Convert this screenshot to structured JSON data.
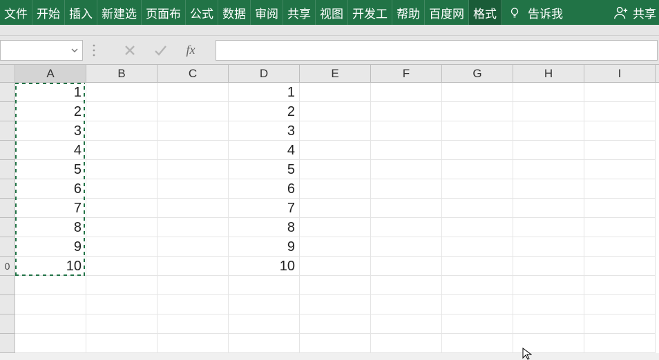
{
  "ribbon": {
    "tabs": [
      {
        "label": "文件"
      },
      {
        "label": "开始"
      },
      {
        "label": "插入"
      },
      {
        "label": "新建选"
      },
      {
        "label": "页面布"
      },
      {
        "label": "公式"
      },
      {
        "label": "数据"
      },
      {
        "label": "审阅"
      },
      {
        "label": "共享"
      },
      {
        "label": "视图"
      },
      {
        "label": "开发工"
      },
      {
        "label": "帮助"
      },
      {
        "label": "百度网"
      },
      {
        "label": "格式",
        "active": true
      }
    ],
    "tell_me": "告诉我",
    "share": "共享"
  },
  "fbar": {
    "namebox": "",
    "fx_label": "fx",
    "formula": ""
  },
  "grid": {
    "cols": [
      "A",
      "B",
      "C",
      "D",
      "E",
      "F",
      "G",
      "H",
      "I"
    ],
    "row_headers": [
      "",
      "",
      "",
      "",
      "",
      "",
      "",
      "",
      "",
      "0",
      "",
      "",
      "",
      ""
    ],
    "cells": {
      "A": [
        "1",
        "2",
        "3",
        "4",
        "5",
        "6",
        "7",
        "8",
        "9",
        "10",
        "",
        "",
        "",
        ""
      ],
      "D": [
        "1",
        "2",
        "3",
        "4",
        "5",
        "6",
        "7",
        "8",
        "9",
        "10",
        "",
        "",
        "",
        ""
      ]
    }
  },
  "chart_data": {
    "type": "table",
    "columns": [
      "A",
      "B",
      "C",
      "D",
      "E",
      "F",
      "G",
      "H",
      "I"
    ],
    "rows": [
      {
        "A": 1,
        "D": 1
      },
      {
        "A": 2,
        "D": 2
      },
      {
        "A": 3,
        "D": 3
      },
      {
        "A": 4,
        "D": 4
      },
      {
        "A": 5,
        "D": 5
      },
      {
        "A": 6,
        "D": 6
      },
      {
        "A": 7,
        "D": 7
      },
      {
        "A": 8,
        "D": 8
      },
      {
        "A": 9,
        "D": 9
      },
      {
        "A": 10,
        "D": 10
      }
    ],
    "selection": "A1:A10",
    "selection_mode": "copy"
  }
}
